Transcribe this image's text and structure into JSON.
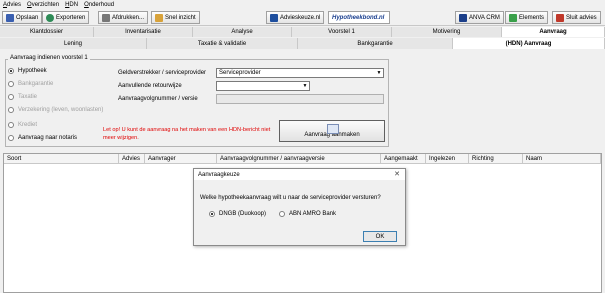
{
  "menu": [
    "Advies",
    "Overzichten",
    "HDN",
    "Onderhoud"
  ],
  "toolbar": {
    "opslaan": "Opslaan",
    "exporteren": "Exporteren",
    "afdrukken": "Afdrukken...",
    "snel_inzicht": "Snel inzicht",
    "advieskeuze": "Advieskeuze.nl",
    "hypotheekbond": "Hypotheekbond.nl",
    "anva": "ANVA CRM",
    "elements": "Elements",
    "sluit": "Sluit advies"
  },
  "tabs_main": [
    "Klantdossier",
    "Inventarisatie",
    "Analyse",
    "Voorstel 1",
    "Motivering",
    "Aanvraag"
  ],
  "tabs_sub": [
    "Lening",
    "Taxatie & validatie",
    "Bankgarantie",
    "(HDN) Aanvraag"
  ],
  "group_label": "Aanvraag indienen voorstel 1",
  "radios": [
    "Hypotheek",
    "Bankgarantie",
    "Taxatie",
    "Verzekering (leven, woonlasten)",
    "Krediet",
    "Aanvraag naar notaris"
  ],
  "fields": {
    "geldverstrekker_label": "Geldverstrekker / serviceprovider",
    "geldverstrekker_value": "Serviceprovider",
    "retourwijze_label": "Aanvullende retourwijze",
    "volgnummer_label": "Aanvraagvolgnummer / versie"
  },
  "warning": "Let op! U kunt de aanvraag na het maken van een HDN-bericht niet meer wijzigen.",
  "create_button": "Aanvraag aanmaken",
  "grid_headers": [
    "Soort",
    "Advies",
    "Aanvrager",
    "Aanvraagvolgnummer / aanvraagversie",
    "Aangemaakt",
    "Ingelezen",
    "Richting",
    "Naam"
  ],
  "dialog": {
    "title": "Aanvraagkeuze",
    "question": "Welke hypotheekaanvraag wilt u naar de serviceprovider versturen?",
    "option1": "DNGB (Duokoop)",
    "option2": "ABN AMRO Bank",
    "ok": "OK"
  },
  "colors": {
    "accent": "#3c7fb1",
    "warning": "#e00000",
    "active_tab": "#ffffff"
  }
}
